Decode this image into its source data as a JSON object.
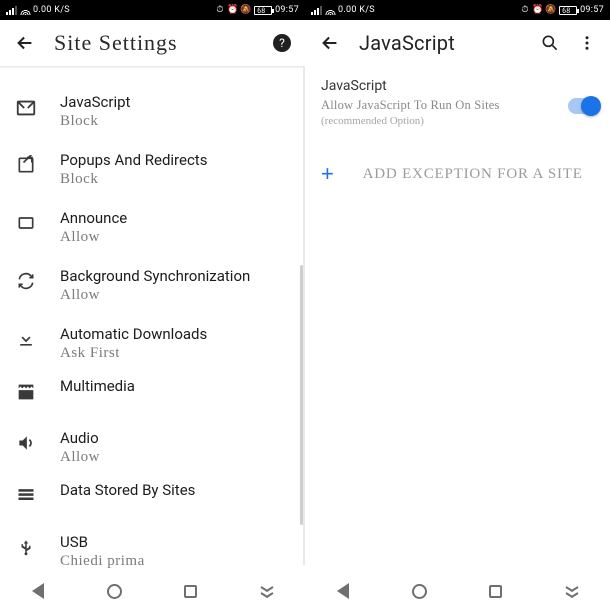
{
  "status": {
    "speed": "0.00 K/S",
    "battery": "68",
    "time": "09:57"
  },
  "left": {
    "title": "Site Settings",
    "items": [
      {
        "label": "JavaScript",
        "sub": "Block"
      },
      {
        "label": "Popups And Redirects",
        "sub": "Block"
      },
      {
        "label": "Announce",
        "sub": "Allow"
      },
      {
        "label": "Background Synchronization",
        "sub": "Allow"
      },
      {
        "label": "Automatic Downloads",
        "sub": "Ask First"
      },
      {
        "label": "Multimedia",
        "sub": ""
      },
      {
        "label": "Audio",
        "sub": "Allow"
      },
      {
        "label": "Data Stored By Sites",
        "sub": ""
      },
      {
        "label": "USB",
        "sub": "Chiedi prima"
      }
    ]
  },
  "right": {
    "title": "JavaScript",
    "setting_title": "JavaScript",
    "setting_sub": "Allow JavaScript To Run On Sites",
    "setting_note": "(recommended Option)",
    "toggle_on": true,
    "add_exception": "ADD EXCEPTION FOR A SITE"
  }
}
